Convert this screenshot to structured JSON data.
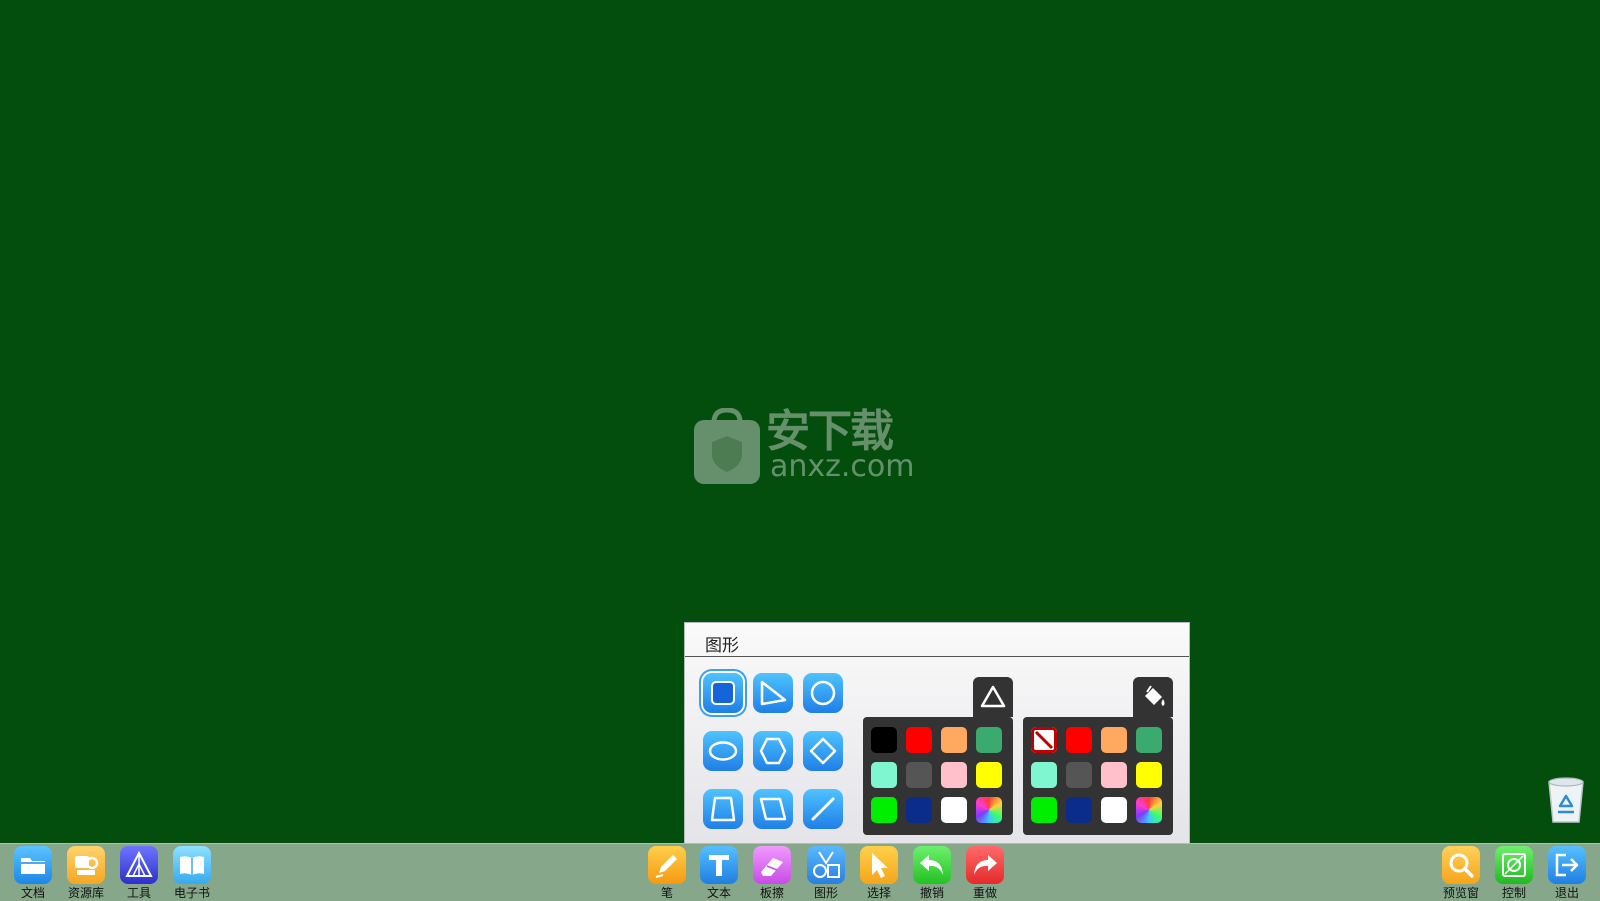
{
  "watermark": {
    "cn_text": "安下载",
    "en_text": "anxz.com"
  },
  "shape_panel": {
    "title": "图形",
    "shapes": [
      "rounded-rectangle",
      "right-triangle",
      "circle",
      "ellipse",
      "hexagon",
      "diamond",
      "trapezoid",
      "parallelogram",
      "line"
    ],
    "selected_shape": "rounded-rectangle",
    "stroke_palette": {
      "tab_icon": "triangle-outline-icon",
      "colors": [
        "#000000",
        "#ff0000",
        "#ffa860",
        "#3aaa6e",
        "#7ff5d0",
        "#555555",
        "#ffc0cb",
        "#ffff00",
        "#00ee00",
        "#0a2c8a",
        "#ffffff",
        "rainbow"
      ]
    },
    "fill_palette": {
      "tab_icon": "paint-bucket-icon",
      "colors": [
        "none",
        "#ff0000",
        "#ffa860",
        "#3aaa6e",
        "#7ff5d0",
        "#555555",
        "#ffc0cb",
        "#ffff00",
        "#00ee00",
        "#0a2c8a",
        "#ffffff",
        "rainbow"
      ]
    }
  },
  "taskbar": {
    "left": [
      {
        "label": "文档",
        "icon": "folder-icon"
      },
      {
        "label": "资源库",
        "icon": "resource-library-icon"
      },
      {
        "label": "工具",
        "icon": "tools-icon"
      },
      {
        "label": "电子书",
        "icon": "ebook-icon"
      }
    ],
    "center": [
      {
        "label": "笔",
        "icon": "pen-icon"
      },
      {
        "label": "文本",
        "icon": "text-icon"
      },
      {
        "label": "板擦",
        "icon": "eraser-icon"
      },
      {
        "label": "图形",
        "icon": "shapes-icon"
      },
      {
        "label": "选择",
        "icon": "select-cursor-icon"
      },
      {
        "label": "撤销",
        "icon": "undo-icon"
      },
      {
        "label": "重做",
        "icon": "redo-icon"
      }
    ],
    "right": [
      {
        "label": "预览窗",
        "icon": "preview-icon"
      },
      {
        "label": "控制",
        "icon": "control-icon"
      },
      {
        "label": "退出",
        "icon": "exit-icon"
      }
    ]
  },
  "colors": {
    "board_background": "#034e0c",
    "taskbar_background": "#86a78a"
  }
}
